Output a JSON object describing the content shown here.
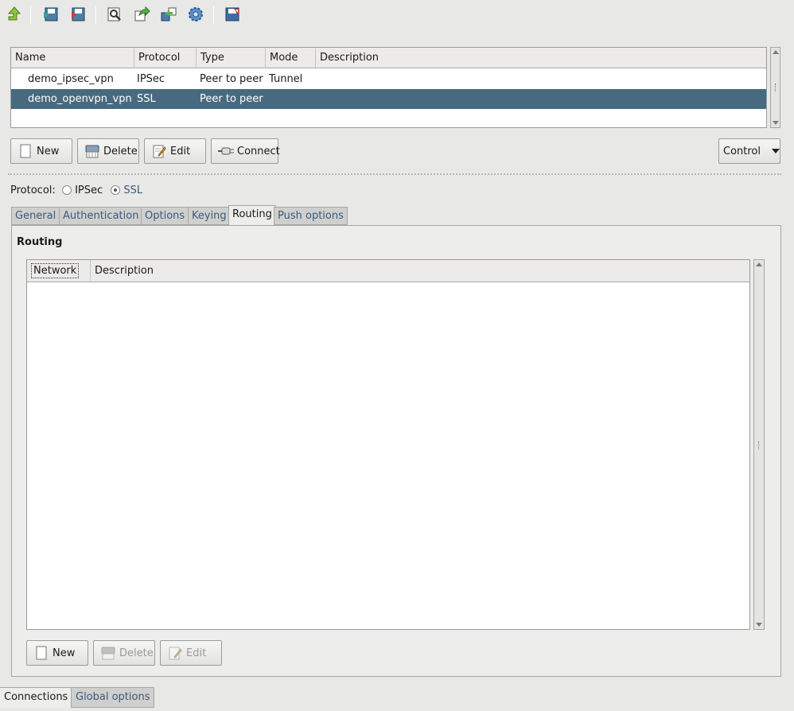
{
  "toolbar": {
    "buttons": [
      {
        "name": "up",
        "icon": "up-arrow-icon"
      },
      {
        "name": "import",
        "icon": "import-icon"
      },
      {
        "name": "export",
        "icon": "export-icon"
      },
      {
        "name": "search",
        "icon": "magnifier-icon"
      },
      {
        "name": "forward",
        "icon": "forward-icon"
      },
      {
        "name": "transfer",
        "icon": "transfer-icon"
      },
      {
        "name": "settings",
        "icon": "gear-icon"
      },
      {
        "name": "save",
        "icon": "save-icon"
      }
    ]
  },
  "connections_table": {
    "columns": [
      "Name",
      "Protocol",
      "Type",
      "Mode",
      "Description"
    ],
    "rows": [
      {
        "name": "demo_ipsec_vpn",
        "protocol": "IPSec",
        "type": "Peer to peer",
        "mode": "Tunnel",
        "description": "",
        "selected": false
      },
      {
        "name": "demo_openvpn_vpn",
        "protocol": "SSL",
        "type": "Peer to peer",
        "mode": "",
        "description": "",
        "selected": true
      }
    ],
    "selected_color": "#486a80"
  },
  "actions": {
    "new": "New",
    "delete": "Delete",
    "edit": "Edit",
    "connect": "Connect",
    "control": "Control"
  },
  "protocol": {
    "label": "Protocol:",
    "options": [
      {
        "label": "IPSec",
        "checked": false
      },
      {
        "label": "SSL",
        "checked": true
      }
    ]
  },
  "tabs": [
    {
      "label": "General",
      "active": false
    },
    {
      "label": "Authentication",
      "active": false
    },
    {
      "label": "Options",
      "active": false
    },
    {
      "label": "Keying",
      "active": false
    },
    {
      "label": "Routing",
      "active": true
    },
    {
      "label": "Push options",
      "active": false
    }
  ],
  "routing": {
    "title": "Routing",
    "columns": [
      "Network",
      "Description"
    ],
    "rows": [],
    "buttons": {
      "new": "New",
      "delete": "Delete",
      "edit": "Edit"
    }
  },
  "bottom_tabs": [
    {
      "label": "Connections",
      "active": true
    },
    {
      "label": "Global options",
      "active": false
    }
  ]
}
